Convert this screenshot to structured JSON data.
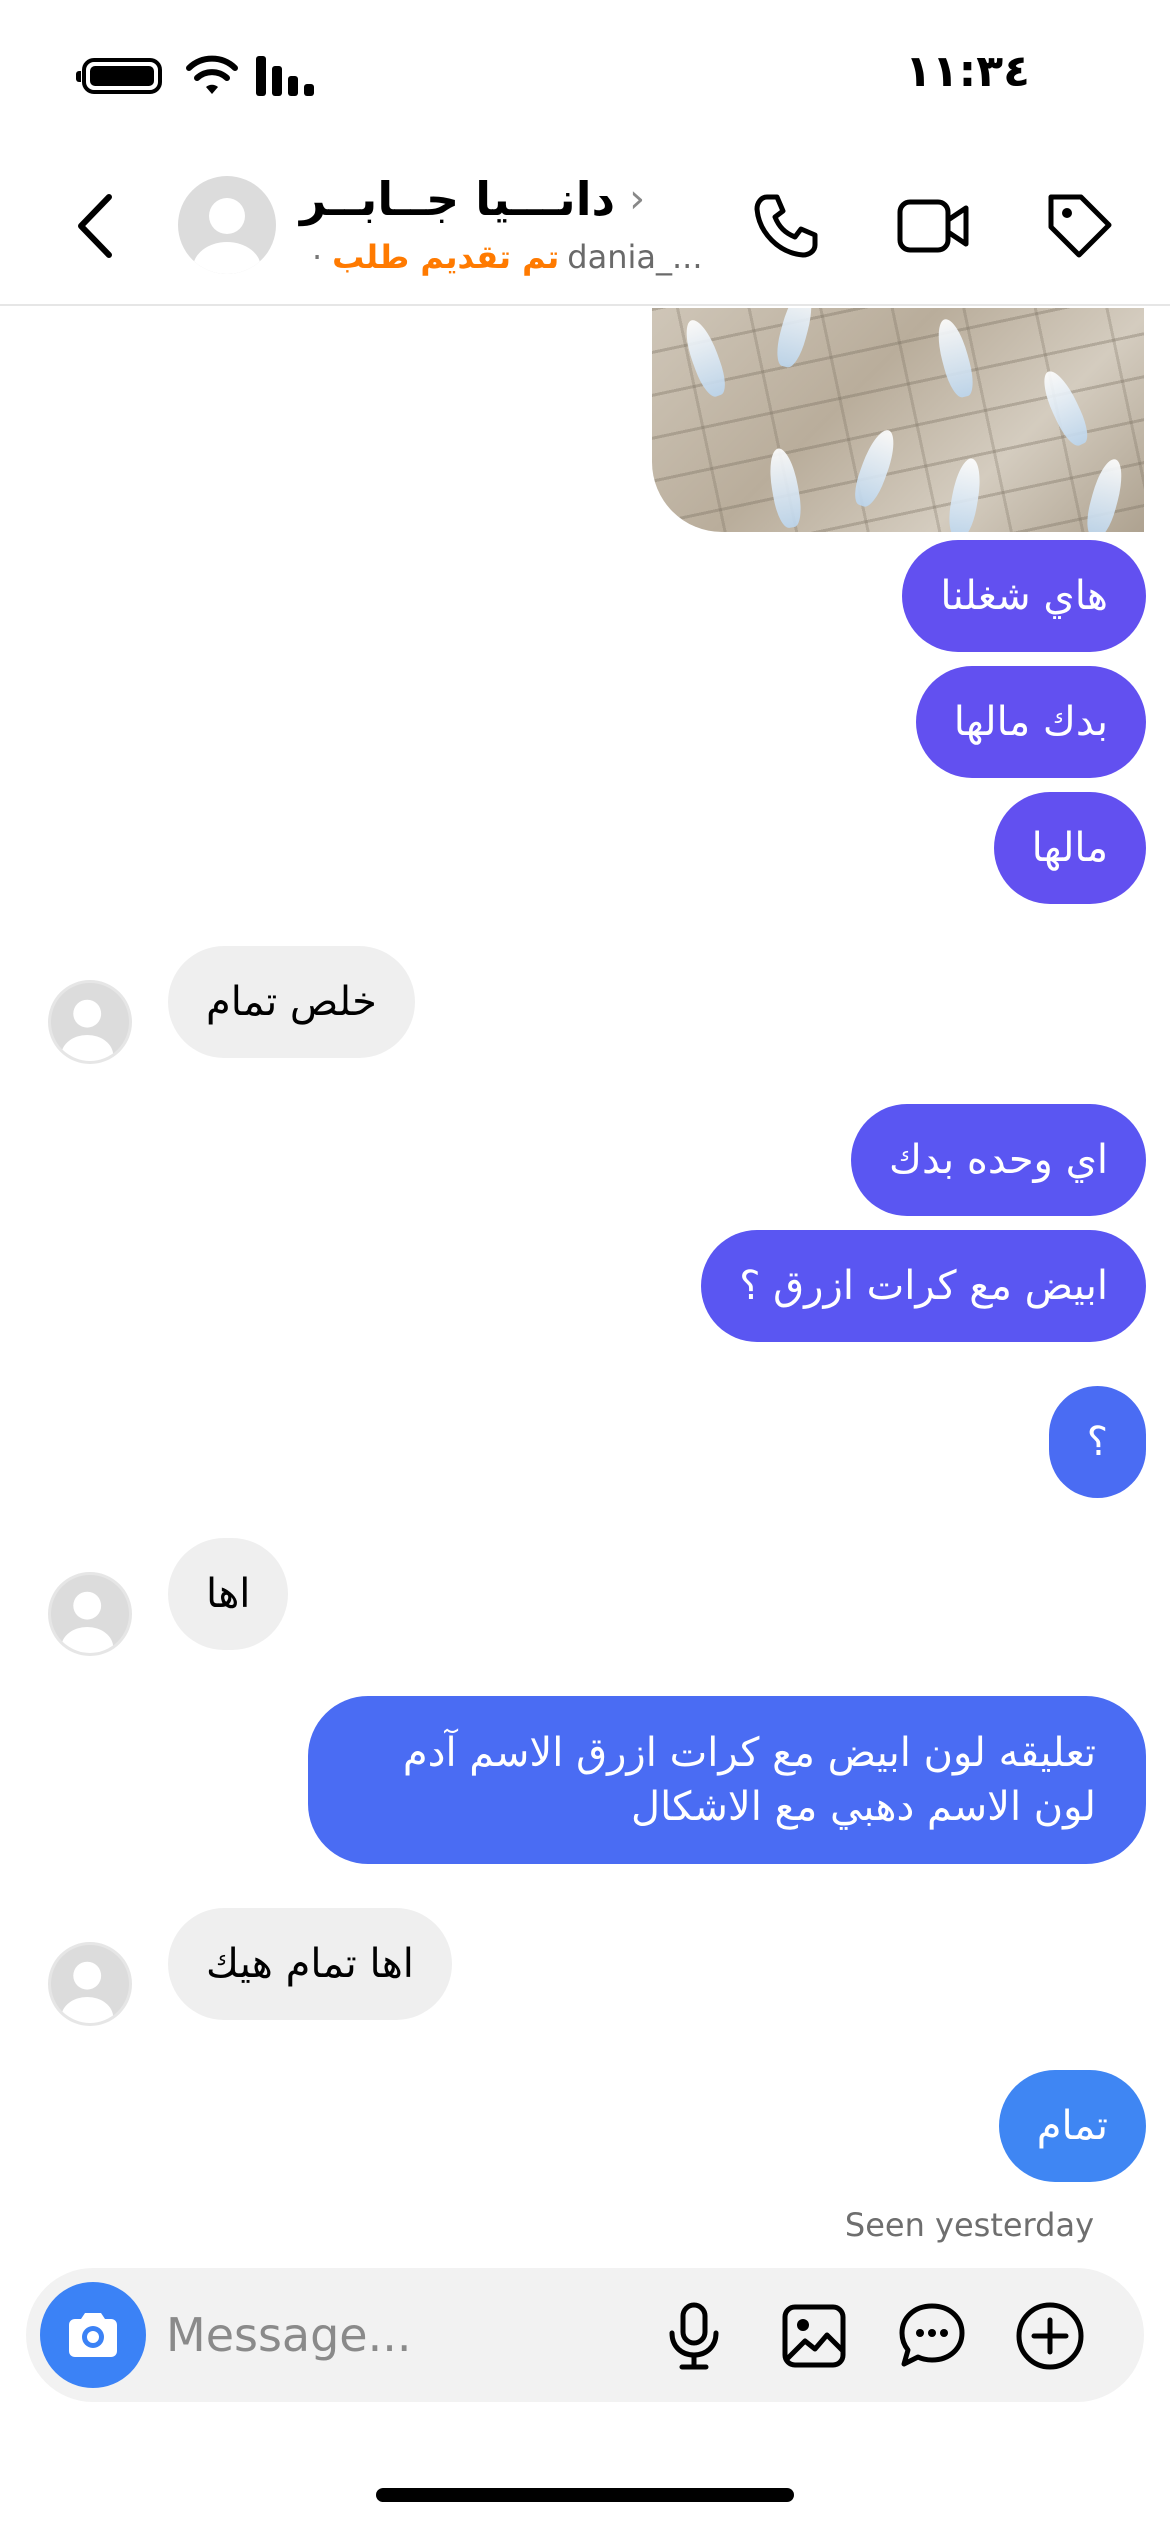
{
  "status_bar": {
    "time": "١١:٣٤"
  },
  "header": {
    "contact_name": "دانـــيا جــابــر",
    "handle": "dania_...",
    "request_status": "تم تقديم طلب",
    "separator": "·"
  },
  "colors": {
    "sent_purple": "#6250f0",
    "sent_indigo": "#5a56f2",
    "sent_blue": "#4a6cf3",
    "sent_lightblue": "#3f86f3",
    "received_bg": "#efefef",
    "status_orange": "#ff7a00",
    "camera_blue": "#3b82f6"
  },
  "messages": [
    {
      "type": "sent",
      "text": "هاي شغلنا"
    },
    {
      "type": "sent",
      "text": "بدك مالها"
    },
    {
      "type": "sent",
      "text": "مالها"
    },
    {
      "type": "received",
      "text": "خلص تمام"
    },
    {
      "type": "sent",
      "text": "اي وحده بدك"
    },
    {
      "type": "sent",
      "text": "ابيض مع كرات ازرق ؟"
    },
    {
      "type": "sent",
      "text": "؟"
    },
    {
      "type": "received",
      "text": "اها"
    },
    {
      "type": "sent",
      "text": "تعليقه لون ابيض مع كرات ازرق الاسم آدم لون الاسم دهبي مع الاشكال"
    },
    {
      "type": "received",
      "text": "اها تمام هيك"
    },
    {
      "type": "sent",
      "text": "تمام"
    }
  ],
  "seen_label": "Seen yesterday",
  "composer": {
    "placeholder": "Message..."
  },
  "icons": {
    "back": "chevron-left-icon",
    "call": "phone-icon",
    "video": "video-camera-icon",
    "tag": "tag-icon",
    "camera": "camera-icon",
    "mic": "microphone-icon",
    "gallery": "image-icon",
    "sticker": "chat-bubble-icon",
    "plus": "plus-circle-icon"
  }
}
